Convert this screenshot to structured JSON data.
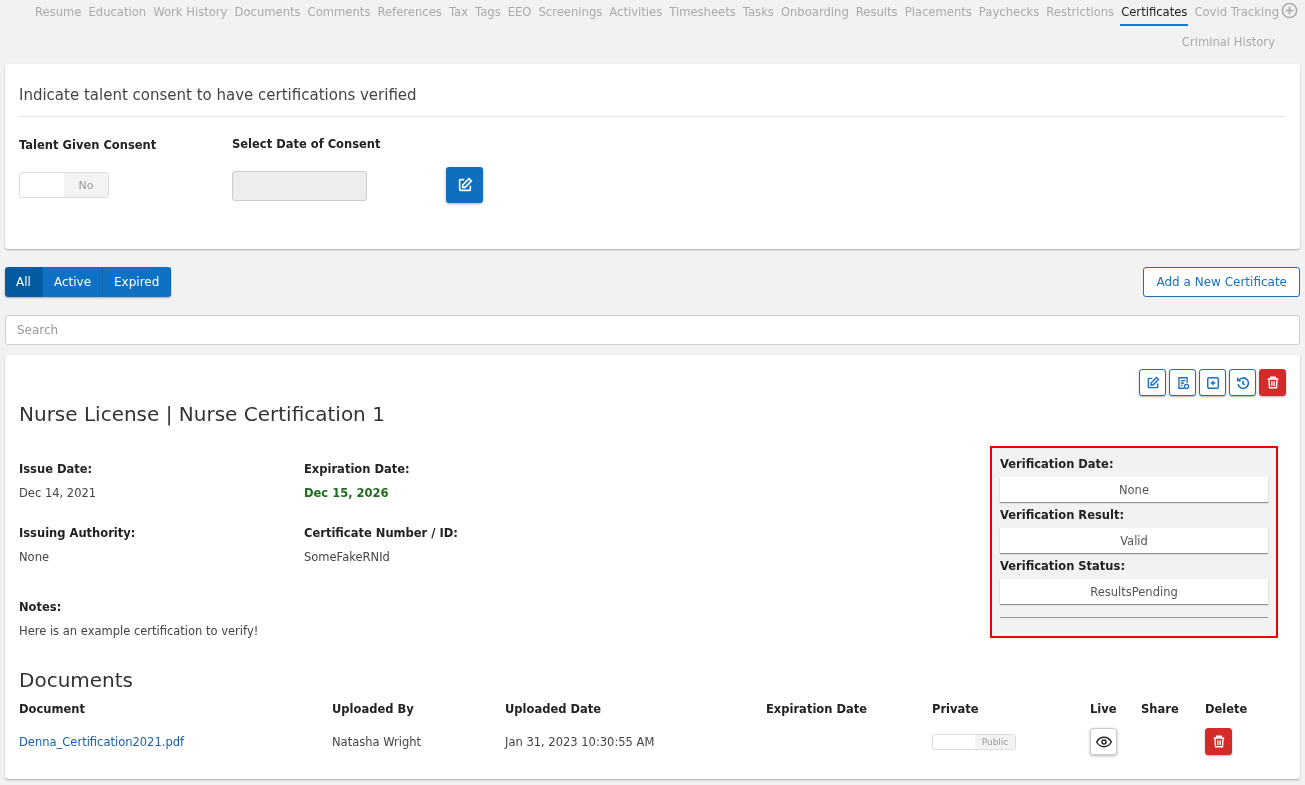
{
  "tabs": [
    {
      "label": "Resume",
      "selected": false
    },
    {
      "label": "Education",
      "selected": false
    },
    {
      "label": "Work History",
      "selected": false
    },
    {
      "label": "Documents",
      "selected": false
    },
    {
      "label": "Comments",
      "selected": false
    },
    {
      "label": "References",
      "selected": false
    },
    {
      "label": "Tax",
      "selected": false
    },
    {
      "label": "Tags",
      "selected": false
    },
    {
      "label": "EEO",
      "selected": false
    },
    {
      "label": "Screenings",
      "selected": false
    },
    {
      "label": "Activities",
      "selected": false
    },
    {
      "label": "Timesheets",
      "selected": false
    },
    {
      "label": "Tasks",
      "selected": false
    },
    {
      "label": "Onboarding",
      "selected": false
    },
    {
      "label": "Results",
      "selected": false
    },
    {
      "label": "Placements",
      "selected": false
    },
    {
      "label": "Paychecks",
      "selected": false
    },
    {
      "label": "Restrictions",
      "selected": false
    },
    {
      "label": "Certificates",
      "selected": true
    },
    {
      "label": "Covid Tracking",
      "selected": false
    },
    {
      "label": "Criminal History",
      "selected": false
    }
  ],
  "consent": {
    "title": "Indicate talent consent to have certifications verified",
    "consent_label": "Talent Given Consent",
    "consent_toggle": {
      "on": false,
      "text": "No"
    },
    "date_label": "Select Date of Consent"
  },
  "filters": [
    {
      "label": "All",
      "selected": true
    },
    {
      "label": "Active",
      "selected": false
    },
    {
      "label": "Expired",
      "selected": false
    }
  ],
  "add_button": "Add a New Certificate",
  "search": {
    "placeholder": "Search"
  },
  "certificate": {
    "title": "Nurse License | Nurse Certification 1",
    "fields": [
      {
        "label": "Issue Date:",
        "value": "Dec 14, 2021"
      },
      {
        "label": "Expiration Date:",
        "value": "Dec 15, 2026",
        "color": "#1e6b1e"
      },
      {
        "label": "Issuing Authority:",
        "value": "None"
      },
      {
        "label": "Certificate Number / ID:",
        "value": "SomeFakeRNId"
      }
    ],
    "notes_label": "Notes:",
    "notes": "Here is an example certification to verify!",
    "verification": {
      "highlighted": true,
      "items": [
        {
          "label": "Verification Date:",
          "value": "None"
        },
        {
          "label": "Verification Result:",
          "value": "Valid"
        },
        {
          "label": "Verification Status:",
          "value": "ResultsPending"
        }
      ]
    }
  },
  "documents": {
    "title": "Documents",
    "columns": [
      "Document",
      "Uploaded By",
      "Uploaded Date",
      "Expiration Date",
      "Private",
      "Live",
      "Share",
      "Delete"
    ],
    "rows": [
      {
        "document": "Denna_Certification2021.pdf",
        "uploaded_by": "Natasha Wright",
        "uploaded_date": "Jan 31, 2023 10:30:55 AM",
        "private_toggle": {
          "on": false,
          "text": "Public"
        }
      }
    ]
  }
}
